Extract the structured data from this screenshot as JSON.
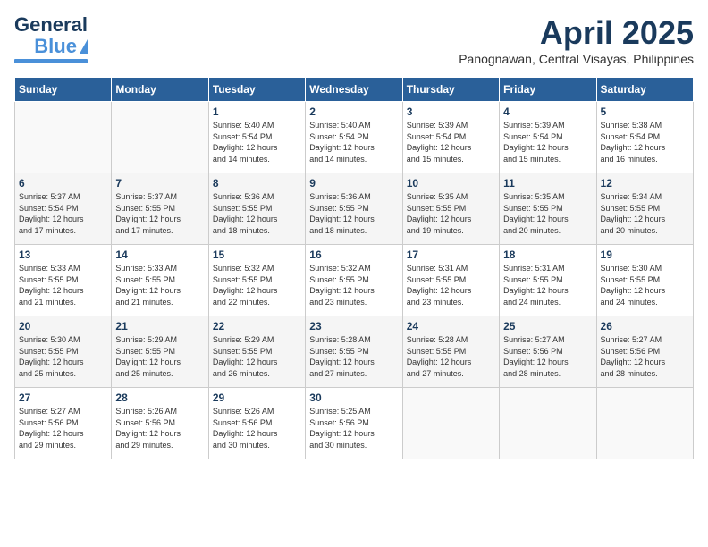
{
  "header": {
    "logo_line1": "General",
    "logo_line2": "Blue",
    "month_title": "April 2025",
    "subtitle": "Panognawan, Central Visayas, Philippines"
  },
  "days_of_week": [
    "Sunday",
    "Monday",
    "Tuesday",
    "Wednesday",
    "Thursday",
    "Friday",
    "Saturday"
  ],
  "weeks": [
    [
      {
        "num": "",
        "info": ""
      },
      {
        "num": "",
        "info": ""
      },
      {
        "num": "1",
        "info": "Sunrise: 5:40 AM\nSunset: 5:54 PM\nDaylight: 12 hours\nand 14 minutes."
      },
      {
        "num": "2",
        "info": "Sunrise: 5:40 AM\nSunset: 5:54 PM\nDaylight: 12 hours\nand 14 minutes."
      },
      {
        "num": "3",
        "info": "Sunrise: 5:39 AM\nSunset: 5:54 PM\nDaylight: 12 hours\nand 15 minutes."
      },
      {
        "num": "4",
        "info": "Sunrise: 5:39 AM\nSunset: 5:54 PM\nDaylight: 12 hours\nand 15 minutes."
      },
      {
        "num": "5",
        "info": "Sunrise: 5:38 AM\nSunset: 5:54 PM\nDaylight: 12 hours\nand 16 minutes."
      }
    ],
    [
      {
        "num": "6",
        "info": "Sunrise: 5:37 AM\nSunset: 5:54 PM\nDaylight: 12 hours\nand 17 minutes."
      },
      {
        "num": "7",
        "info": "Sunrise: 5:37 AM\nSunset: 5:55 PM\nDaylight: 12 hours\nand 17 minutes."
      },
      {
        "num": "8",
        "info": "Sunrise: 5:36 AM\nSunset: 5:55 PM\nDaylight: 12 hours\nand 18 minutes."
      },
      {
        "num": "9",
        "info": "Sunrise: 5:36 AM\nSunset: 5:55 PM\nDaylight: 12 hours\nand 18 minutes."
      },
      {
        "num": "10",
        "info": "Sunrise: 5:35 AM\nSunset: 5:55 PM\nDaylight: 12 hours\nand 19 minutes."
      },
      {
        "num": "11",
        "info": "Sunrise: 5:35 AM\nSunset: 5:55 PM\nDaylight: 12 hours\nand 20 minutes."
      },
      {
        "num": "12",
        "info": "Sunrise: 5:34 AM\nSunset: 5:55 PM\nDaylight: 12 hours\nand 20 minutes."
      }
    ],
    [
      {
        "num": "13",
        "info": "Sunrise: 5:33 AM\nSunset: 5:55 PM\nDaylight: 12 hours\nand 21 minutes."
      },
      {
        "num": "14",
        "info": "Sunrise: 5:33 AM\nSunset: 5:55 PM\nDaylight: 12 hours\nand 21 minutes."
      },
      {
        "num": "15",
        "info": "Sunrise: 5:32 AM\nSunset: 5:55 PM\nDaylight: 12 hours\nand 22 minutes."
      },
      {
        "num": "16",
        "info": "Sunrise: 5:32 AM\nSunset: 5:55 PM\nDaylight: 12 hours\nand 23 minutes."
      },
      {
        "num": "17",
        "info": "Sunrise: 5:31 AM\nSunset: 5:55 PM\nDaylight: 12 hours\nand 23 minutes."
      },
      {
        "num": "18",
        "info": "Sunrise: 5:31 AM\nSunset: 5:55 PM\nDaylight: 12 hours\nand 24 minutes."
      },
      {
        "num": "19",
        "info": "Sunrise: 5:30 AM\nSunset: 5:55 PM\nDaylight: 12 hours\nand 24 minutes."
      }
    ],
    [
      {
        "num": "20",
        "info": "Sunrise: 5:30 AM\nSunset: 5:55 PM\nDaylight: 12 hours\nand 25 minutes."
      },
      {
        "num": "21",
        "info": "Sunrise: 5:29 AM\nSunset: 5:55 PM\nDaylight: 12 hours\nand 25 minutes."
      },
      {
        "num": "22",
        "info": "Sunrise: 5:29 AM\nSunset: 5:55 PM\nDaylight: 12 hours\nand 26 minutes."
      },
      {
        "num": "23",
        "info": "Sunrise: 5:28 AM\nSunset: 5:55 PM\nDaylight: 12 hours\nand 27 minutes."
      },
      {
        "num": "24",
        "info": "Sunrise: 5:28 AM\nSunset: 5:55 PM\nDaylight: 12 hours\nand 27 minutes."
      },
      {
        "num": "25",
        "info": "Sunrise: 5:27 AM\nSunset: 5:56 PM\nDaylight: 12 hours\nand 28 minutes."
      },
      {
        "num": "26",
        "info": "Sunrise: 5:27 AM\nSunset: 5:56 PM\nDaylight: 12 hours\nand 28 minutes."
      }
    ],
    [
      {
        "num": "27",
        "info": "Sunrise: 5:27 AM\nSunset: 5:56 PM\nDaylight: 12 hours\nand 29 minutes."
      },
      {
        "num": "28",
        "info": "Sunrise: 5:26 AM\nSunset: 5:56 PM\nDaylight: 12 hours\nand 29 minutes."
      },
      {
        "num": "29",
        "info": "Sunrise: 5:26 AM\nSunset: 5:56 PM\nDaylight: 12 hours\nand 30 minutes."
      },
      {
        "num": "30",
        "info": "Sunrise: 5:25 AM\nSunset: 5:56 PM\nDaylight: 12 hours\nand 30 minutes."
      },
      {
        "num": "",
        "info": ""
      },
      {
        "num": "",
        "info": ""
      },
      {
        "num": "",
        "info": ""
      }
    ]
  ]
}
